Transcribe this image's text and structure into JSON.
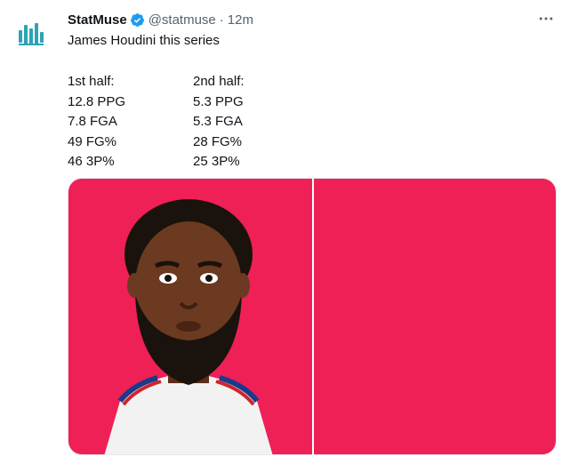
{
  "author": {
    "display_name": "StatMuse",
    "handle": "@statmuse",
    "separator": "·",
    "time": "12m",
    "avatar_icon": "statmuse-logo-icon",
    "verified_icon": "verified-badge-icon"
  },
  "tweet": {
    "text": "James Houdini this series",
    "stats": {
      "first_half": {
        "header": "1st half:",
        "rows": [
          "12.8 PPG",
          "7.8 FGA",
          "49 FG%",
          "46 3P%"
        ]
      },
      "second_half": {
        "header": "2nd half:",
        "rows": [
          "5.3 PPG",
          "5.3 FGA",
          "28 FG%",
          "25 3P%"
        ]
      }
    }
  },
  "media": {
    "left_image": "player-illustration",
    "right_image": "blank-red-panel"
  },
  "menu_icon": "more-options-icon",
  "colors": {
    "text": "#0f1419",
    "muted": "#536471",
    "verified": "#1d9bf0",
    "media_red": "#ee2056",
    "logo_teal": "#2ea2b6"
  }
}
